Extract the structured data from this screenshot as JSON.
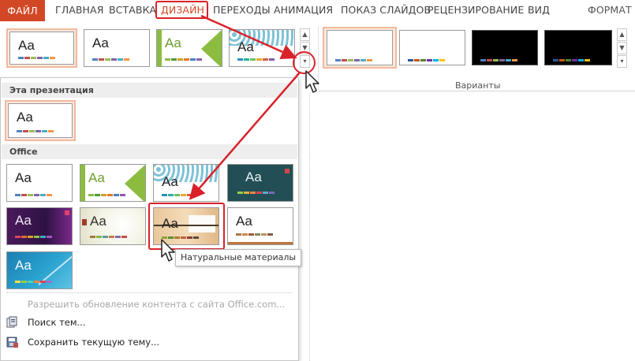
{
  "ribbon": {
    "tabs": [
      {
        "label": "ФАЙЛ"
      },
      {
        "label": "ГЛАВНАЯ"
      },
      {
        "label": "ВСТАВКА"
      },
      {
        "label": "ДИЗАЙН"
      },
      {
        "label": "ПЕРЕХОДЫ"
      },
      {
        "label": "АНИМАЦИЯ"
      },
      {
        "label": "ПОКАЗ СЛАЙДОВ"
      },
      {
        "label": "РЕЦЕНЗИРОВАНИЕ"
      },
      {
        "label": "ВИД"
      },
      {
        "label": "ФОРМАТ"
      }
    ],
    "active_tab": "ДИЗАЙН",
    "variants_label": "Варианты"
  },
  "gallery": {
    "sample_text": "Aa",
    "section_this": "Эта презентация",
    "section_office": "Office",
    "tooltip": "Натуральные материалы"
  },
  "menu": {
    "enable_updates": "Разрешить обновление контента с сайта Office.com...",
    "browse_themes": "Поиск тем...",
    "save_theme": "Сохранить текущую тему..."
  },
  "colors": {
    "accent": "#d24726",
    "annotation_red": "#d9222a",
    "swatch_default": [
      "#4f81bd",
      "#c0504d",
      "#9bbb59",
      "#8064a2",
      "#4bacc6",
      "#f79646"
    ]
  }
}
